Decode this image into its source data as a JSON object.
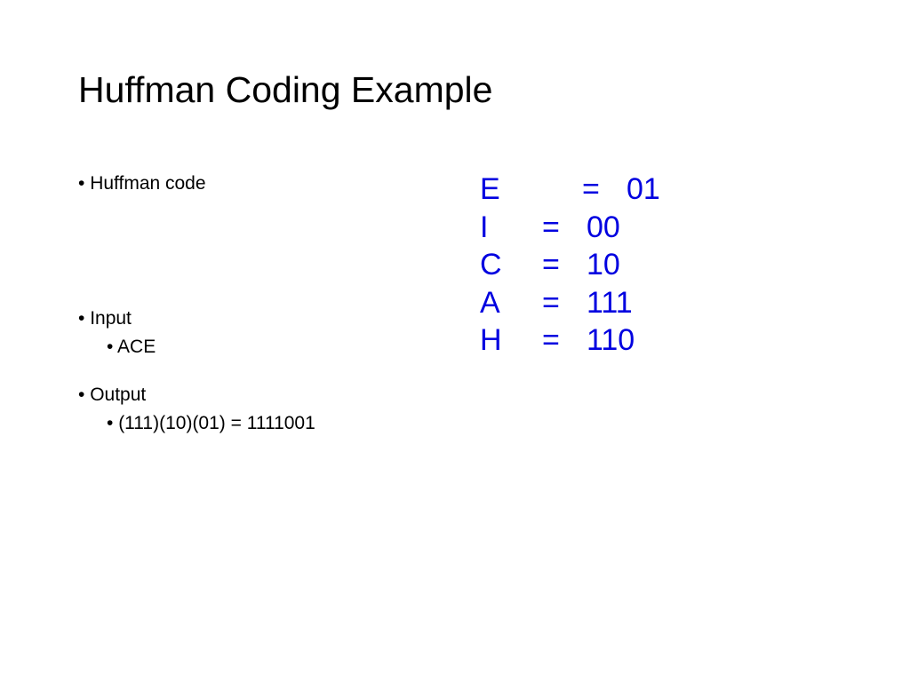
{
  "title": "Huffman Coding Example",
  "bullets": {
    "b1": "Huffman code",
    "b2": "Input",
    "b2_sub": "ACE",
    "b3": "Output",
    "b3_sub": "(111)(10)(01) = 1111001"
  },
  "codes": {
    "e_letter": "E",
    "e_val": "01",
    "i_letter": "I",
    "i_val": "00",
    "c_letter": "C",
    "c_val": "10",
    "a_letter": "A",
    "a_val": "111",
    "h_letter": "H",
    "h_val": "110",
    "eq": "="
  }
}
